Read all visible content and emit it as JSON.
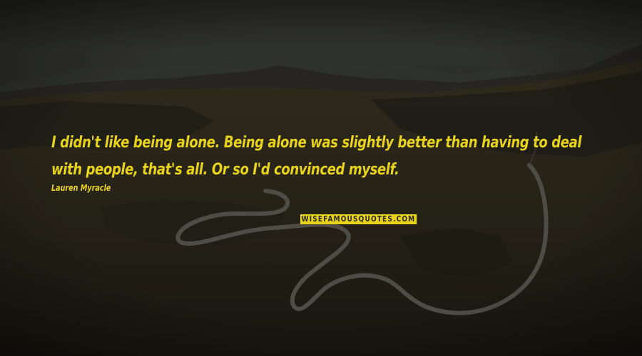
{
  "quote": {
    "text": "I didn't like being alone. Being alone was slightly better than having to deal with people, that's all. Or so I'd convinced myself."
  },
  "author": {
    "name": "Lauren Myracle"
  },
  "watermark": {
    "text": "WISEFAMOUSQUOTES.COM"
  },
  "colors": {
    "quote_text": "#e8d31a",
    "author_text": "#e8d31a",
    "watermark_bg": "#e8d31a",
    "watermark_text": "#2a2a2a",
    "sky": "#33352f",
    "mountains": "#2e2d28",
    "valley": "#3a3423",
    "road": "#5b5a50"
  },
  "background": {
    "scene": "mountain-valley-road-dimmed"
  }
}
